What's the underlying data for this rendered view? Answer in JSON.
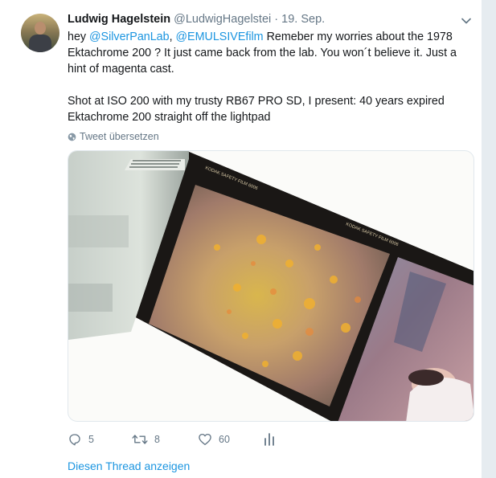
{
  "tweet": {
    "author_name": "Ludwig Hagelstein",
    "author_handle": "@LudwigHagelstei",
    "separator": "·",
    "date": "19. Sep.",
    "text": {
      "line1_prefix": "hey ",
      "mention1": "@SilverPanLab",
      "comma": ", ",
      "mention2": "@EMULSIVEfilm",
      "line1_rest": " Remeber my worries about the 1978 Ektachrome 200 ? It just came back from the lab. You won´t believe it. Just a hint of magenta cast.",
      "paragraph2": "Shot at ISO 200 with my trusty RB67 PRO SD, I present: 40 years expired Ektachrome 200 straight off the lightpad"
    },
    "translate_label": "Tweet übersetzen",
    "media": {
      "film_edge_text": "KODAK SAFETY FILM 6006"
    },
    "actions": {
      "replies": "5",
      "retweets": "8",
      "likes": "60"
    },
    "show_thread": "Diesen Thread anzeigen"
  },
  "icons": {
    "menu": "chevron-down-icon",
    "translate": "globe-icon",
    "reply": "reply-icon",
    "retweet": "retweet-icon",
    "like": "heart-icon",
    "analytics": "analytics-icon"
  },
  "colors": {
    "link": "#1b95e0",
    "secondary_text": "#657786",
    "primary_text": "#14171a"
  }
}
